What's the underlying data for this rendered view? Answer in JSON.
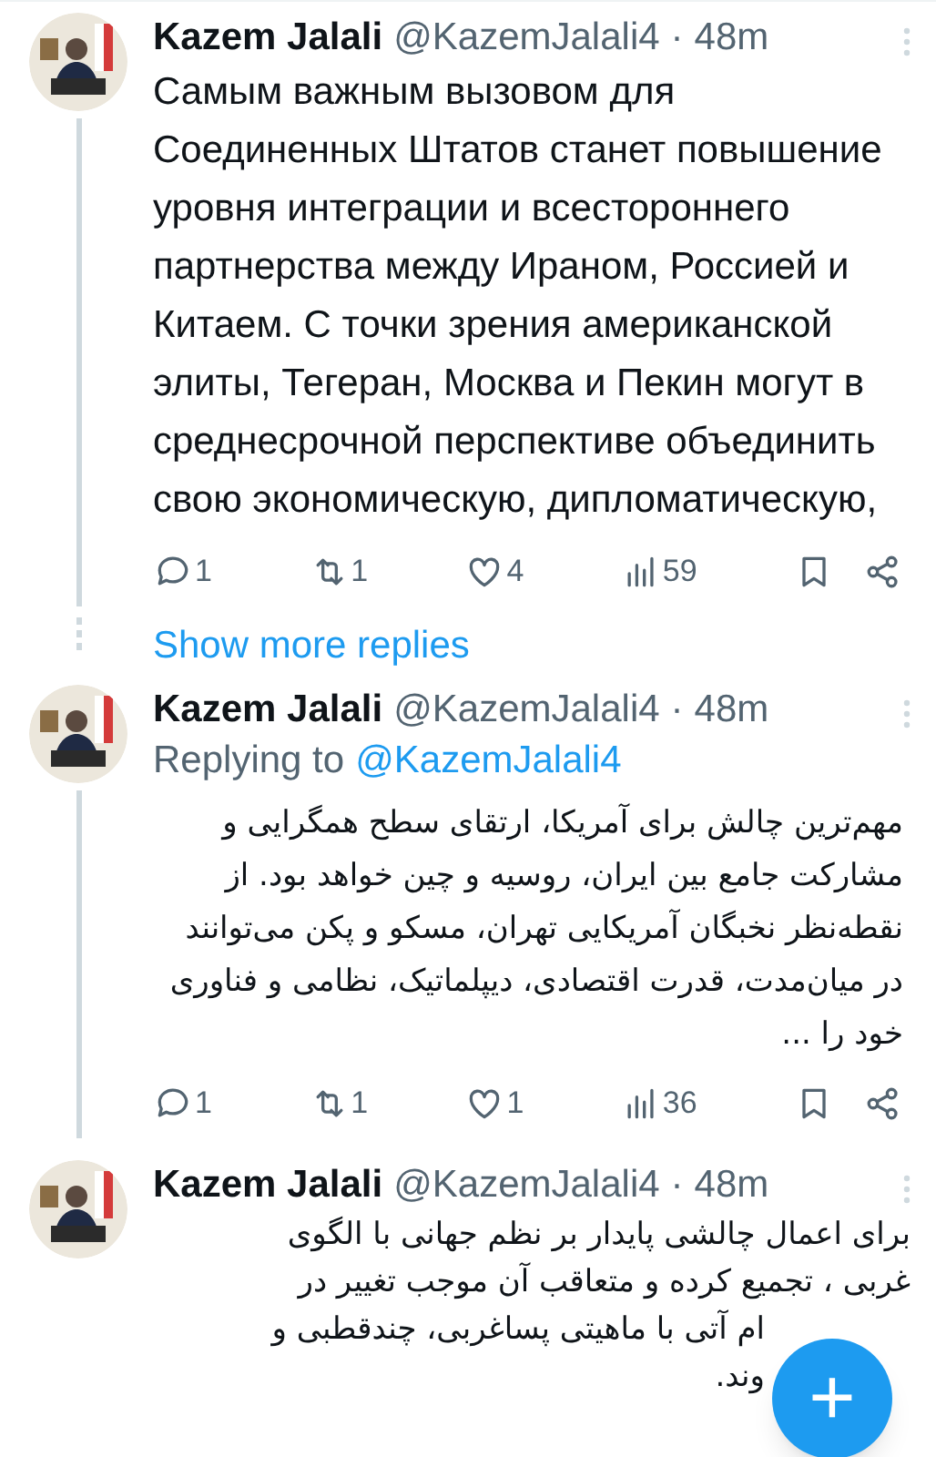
{
  "tweets": [
    {
      "author": "Kazem Jalali",
      "handle": "@KazemJalali4",
      "separator": "·",
      "time": "48m",
      "thread_line": true,
      "kind": "russian",
      "text": "Самым важным вызовом для Соединенных Штатов станет повышение уровня интеграции и всестороннего партнерства между Ираном, Россией и Китаем. С точки зрения американской элиты, Тегеран, Москва и Пекин могут в среднесрочной перспективе объединить свою экономическую, дипломатическую,",
      "stats": {
        "replies": "1",
        "reposts": "1",
        "likes": "4",
        "views": "59"
      },
      "show_more": "Show more replies"
    },
    {
      "author": "Kazem Jalali",
      "handle": "@KazemJalali4",
      "separator": "·",
      "time": "48m",
      "thread_line": true,
      "replying_label": "Replying to",
      "replying_to": "@KazemJalali4",
      "kind": "persian",
      "text": "مهم‌ترین چالش برای آمریکا، ارتقای سطح همگرایی و مشارکت جامع بین ایران، روسیه و چین خواهد بود. از نقطه‌نظر نخبگان آمریکایی تهران، مسکو و پکن می‌توانند در میان‌مدت، قدرت اقتصادی، دیپلماتیک، نظامی و فناوری خود را ...",
      "stats": {
        "replies": "1",
        "reposts": "1",
        "likes": "1",
        "views": "36"
      }
    },
    {
      "author": "Kazem Jalali",
      "handle": "@KazemJalali4",
      "separator": "·",
      "time": "48m",
      "thread_line": false,
      "kind": "persian",
      "lines": [
        "برای اعمال چالشی پایدار بر نظم جهانی با الگوی",
        "غربی ، تجمیع کرده و متعاقب آن موجب تغییر در",
        "ام آتی با ماهیتی پساغربی، چندقطبی و",
        "وند."
      ]
    }
  ],
  "fab": {
    "label": "+"
  }
}
